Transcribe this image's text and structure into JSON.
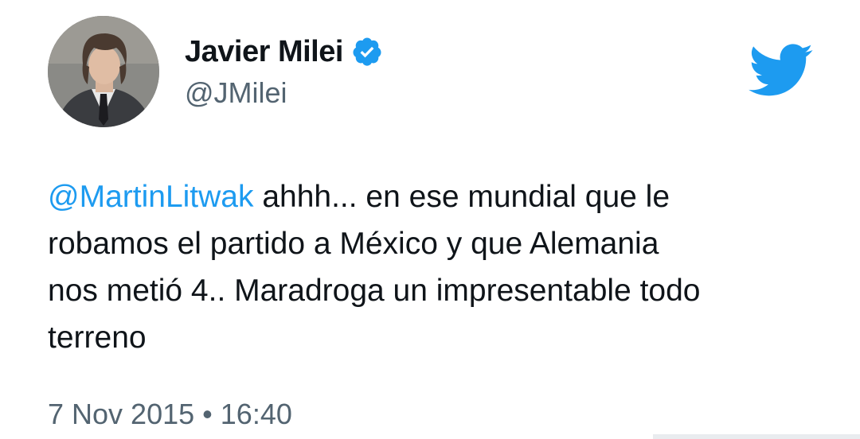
{
  "author": {
    "display_name": "Javier Milei",
    "handle": "@JMilei",
    "verified": true,
    "avatar_icon": "profile-photo"
  },
  "tweet": {
    "mention": "@MartinLitwak",
    "line1_rest": " ahhh... en ese mundial que le",
    "line2": "robamos el partido a México y que Alemania",
    "line3": "nos metió 4.. Maradroga un impresentable todo",
    "line4": "terreno",
    "date": "7 Nov 2015",
    "separator": "•",
    "time": "16:40"
  },
  "brand": {
    "icon": "twitter-bird-icon",
    "color": "#1d9bf0",
    "verified_badge_color": "#1d9bf0"
  }
}
